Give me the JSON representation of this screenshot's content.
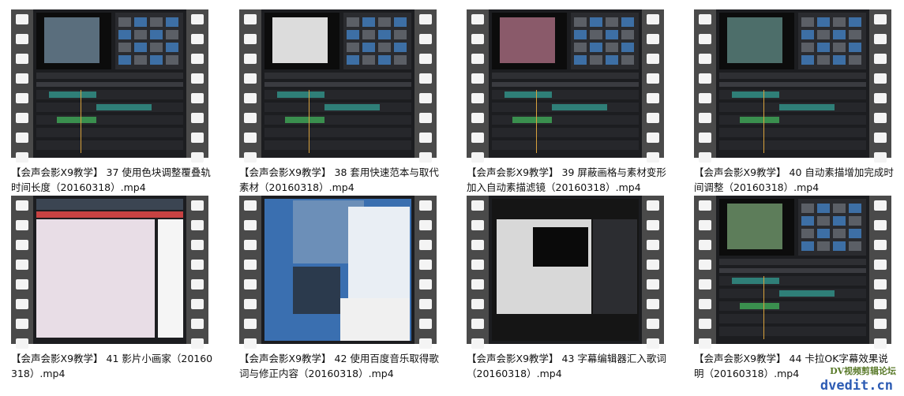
{
  "videos": [
    {
      "caption": "【会声会影X9教学】 37 使用色块调整覆叠轨时间长度（20160318）.mp4",
      "preview": "video-editor-timeline-screen"
    },
    {
      "caption": "【会声会影X9教学】 38 套用快速范本与取代素材（20160318）.mp4",
      "preview": "video-editor-template-screen"
    },
    {
      "caption": "【会声会影X9教学】 39 屏蔽画格与素材变形加入自动素描滤镜（20160318）.mp4",
      "preview": "video-editor-mask-screen"
    },
    {
      "caption": "【会声会影X9教学】 40 自动素描增加完成时间调整（20160318）.mp4",
      "preview": "video-editor-sketch-screen"
    },
    {
      "caption": "【会声会影X9教学】 41 影片小画家（20160318）.mp4",
      "preview": "painter-screen"
    },
    {
      "caption": "【会声会影X9教学】 42 使用百度音乐取得歌词与修正内容（20160318）.mp4",
      "preview": "music-player-screen"
    },
    {
      "caption": "【会声会影X9教学】 43 字幕编辑器汇入歌词（20160318）.mp4",
      "preview": "subtitle-editor-screen"
    },
    {
      "caption": "【会声会影X9教学】 44 卡拉OK字幕效果说明（20160318）.mp4",
      "preview": "karaoke-subtitle-screen"
    }
  ],
  "watermark": {
    "line1": "DV视频剪辑论坛",
    "line2": "dvedit.cn"
  }
}
